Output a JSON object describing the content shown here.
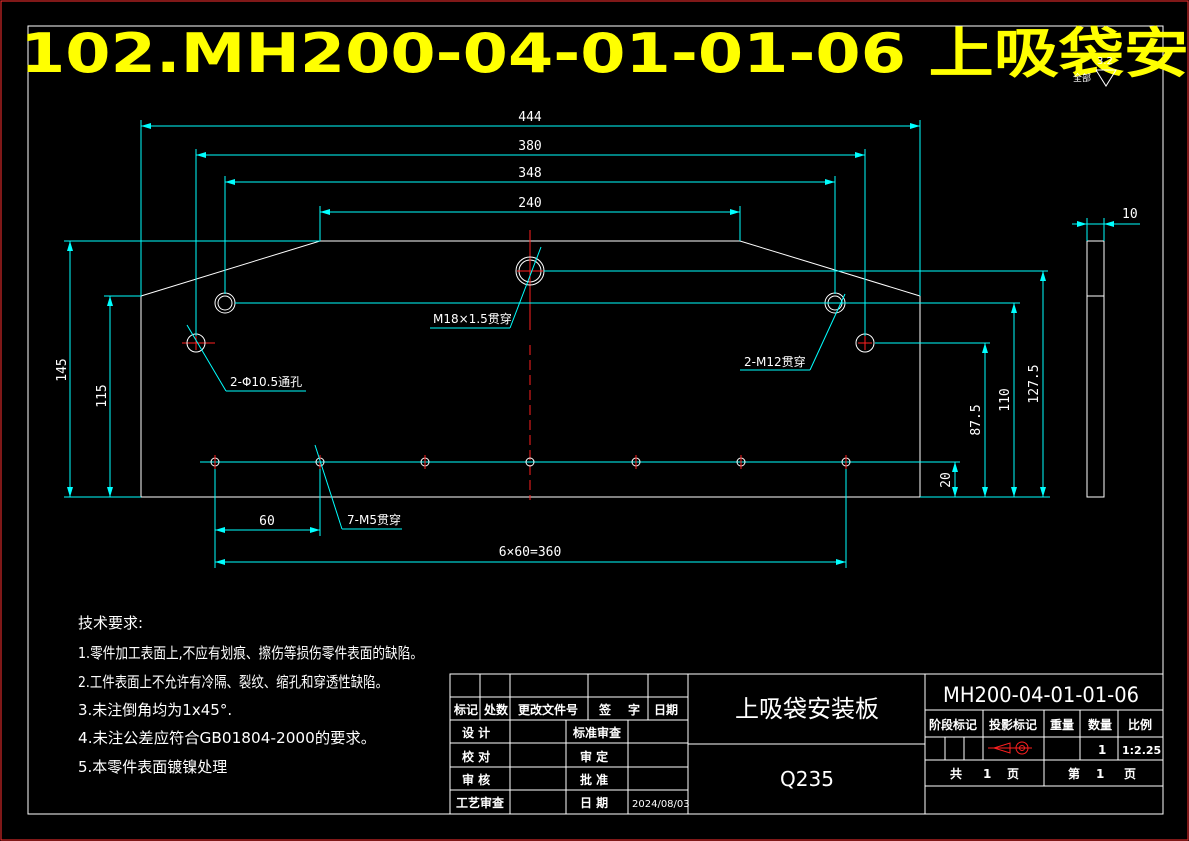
{
  "title_banner": "102.MH200-04-01-01-06 上吸袋安",
  "surface_finish": {
    "prefix": "全部",
    "value": "3.2"
  },
  "dimensions": {
    "overall_width": "444",
    "hole_span_380": "380",
    "hole_span_348": "348",
    "top_edge": "240",
    "thickness": "10",
    "height_145": "145",
    "height_115": "115",
    "height_127_5": "127.5",
    "height_110": "110",
    "height_87_5": "87.5",
    "height_20": "20",
    "pitch_60": "60",
    "pitch_total": "6×60=360"
  },
  "callouts": {
    "center_hole": "M18×1.5贯穿",
    "side_holes": "2-Φ10.5通孔",
    "tapped_holes": "2-M12贯穿",
    "row_holes": "7-M5贯穿"
  },
  "tech_requirements": {
    "heading": "技术要求:",
    "items": [
      "1.零件加工表面上,不应有划痕、擦伤等损伤零件表面的缺陷。",
      "2.工件表面上不允许有冷隔、裂纹、缩孔和穿透性缺陷。",
      "3.未注倒角均为1x45°.",
      "4.未注公差应符合GB01804-2000的要求。",
      "5.本零件表面镀镍处理"
    ]
  },
  "title_block": {
    "headers": [
      "标记",
      "处数",
      "更改文件号",
      "签",
      "字",
      "日期"
    ],
    "design": "设 计",
    "standard_review": "标准审查",
    "proof": "校 对",
    "review": "审 定",
    "audit": "审 核",
    "approve": "批 准",
    "process_review": "工艺审查",
    "date_label": "日 期",
    "date_value": "2024/08/03",
    "part_name": "上吸袋安装板",
    "material": "Q235",
    "drawing_number": "MH200-04-01-01-06",
    "stage_mark": "阶段标记",
    "projection_mark": "投影标记",
    "weight": "重量",
    "quantity": "数量",
    "scale": "比例",
    "quantity_value": "1",
    "scale_value": "1:2.25",
    "total_label": "共",
    "total_value": "1",
    "page_unit": "页",
    "sheet_label": "第",
    "sheet_value": "1",
    "sheet_unit": "页"
  },
  "colors": {
    "background": "#000000",
    "outline": "#ffffff",
    "dimension": "#00ffff",
    "text": "#00ff00",
    "banner": "#ffff00",
    "border": "#ff0000",
    "centerline": "#ff0000"
  }
}
